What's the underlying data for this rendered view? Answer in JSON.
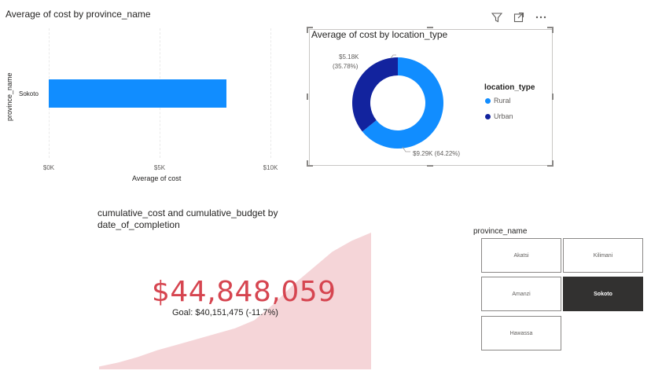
{
  "bar_visual": {
    "title": "Average of cost by province_name",
    "y_axis_title": "province_name",
    "x_axis_title": "Average of cost"
  },
  "donut_visual": {
    "title": "Average of cost by location_type",
    "legend_title": "location_type",
    "labels": {
      "urban_value": "$5.18K",
      "urban_pct": "(35.78%)",
      "rural": "$9.29K (64.22%)"
    }
  },
  "kpi_visual": {
    "title_line1": "cumulative_cost and cumulative_budget by",
    "title_line2": "date_of_completion",
    "value": "$44,848,059",
    "goal": "Goal: $40,151,475 (-11.7%)"
  },
  "slicer": {
    "title": "province_name",
    "items": [
      {
        "label": "Akatsi",
        "selected": false
      },
      {
        "label": "Kilimani",
        "selected": false
      },
      {
        "label": "Amanzi",
        "selected": false
      },
      {
        "label": "Sokoto",
        "selected": true
      },
      {
        "label": "Hawassa",
        "selected": false
      }
    ]
  },
  "colors": {
    "bar": "#118dff",
    "rural": "#118dff",
    "urban": "#12239e",
    "kpi_value": "#d64550",
    "kpi_area": "#f5d5d8",
    "selected_tile": "#323130"
  },
  "header_icons": [
    "filter-icon",
    "focus-mode-icon",
    "more-options-icon"
  ],
  "chart_data": [
    {
      "type": "bar",
      "orientation": "horizontal",
      "title": "Average of cost by province_name",
      "categories": [
        "Sokoto"
      ],
      "values": [
        8000
      ],
      "xlabel": "Average of cost",
      "ylabel": "province_name",
      "xticks": [
        "$0K",
        "$5K",
        "$10K"
      ],
      "xlim": [
        0,
        10000
      ],
      "grid": true
    },
    {
      "type": "pie",
      "variant": "donut",
      "title": "Average of cost by location_type",
      "legend_title": "location_type",
      "legend_placement": "right",
      "slices": [
        {
          "name": "Rural",
          "value": 9290,
          "percent": 64.22,
          "label": "$9.29K (64.22%)"
        },
        {
          "name": "Urban",
          "value": 5180,
          "percent": 35.78,
          "label": "$5.18K (35.78%)"
        }
      ]
    },
    {
      "type": "area",
      "title": "cumulative_cost and cumulative_budget by date_of_completion",
      "values": [
        0.02,
        0.05,
        0.09,
        0.14,
        0.18,
        0.22,
        0.26,
        0.3,
        0.36,
        0.48,
        0.62,
        0.74,
        0.86,
        0.94,
        1.0
      ],
      "ylim": [
        0,
        1
      ]
    }
  ]
}
